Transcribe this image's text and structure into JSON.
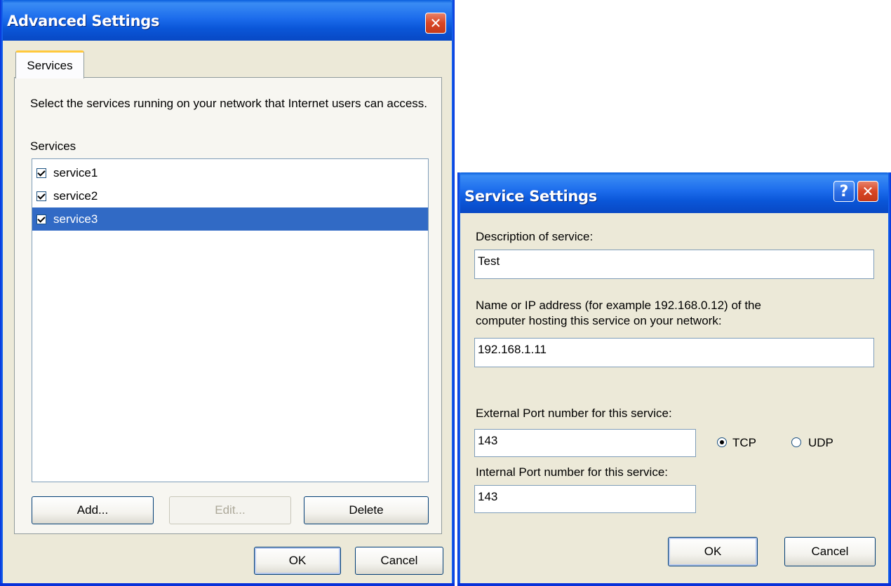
{
  "advanced_dialog": {
    "title": "Advanced Settings",
    "tab_label": "Services",
    "description": "Select the services running on your network that Internet users can access.",
    "services_label": "Services",
    "services": [
      {
        "name": "service1",
        "checked": true,
        "selected": false
      },
      {
        "name": "service2",
        "checked": true,
        "selected": false
      },
      {
        "name": "service3",
        "checked": true,
        "selected": true
      }
    ],
    "add_label": "Add...",
    "edit_label": "Edit...",
    "delete_label": "Delete",
    "ok_label": "OK",
    "cancel_label": "Cancel"
  },
  "service_dialog": {
    "title": "Service Settings",
    "help_glyph": "?",
    "description_label": "Description of service:",
    "description_value": "Test",
    "host_label_line1": "Name or IP address (for example 192.168.0.12) of the",
    "host_label_line2": "computer hosting this service on your network:",
    "host_value": "192.168.1.11",
    "external_port_label": "External Port number for this service:",
    "external_port_value": "143",
    "internal_port_label": "Internal Port number for this service:",
    "internal_port_value": "143",
    "protocol_options": [
      {
        "label": "TCP",
        "checked": true
      },
      {
        "label": "UDP",
        "checked": false
      }
    ],
    "ok_label": "OK",
    "cancel_label": "Cancel"
  },
  "colors": {
    "titlebar": "#0a56d8",
    "dialog_bg": "#ece9d8",
    "selection": "#316ac5",
    "close_button": "#d94625"
  }
}
